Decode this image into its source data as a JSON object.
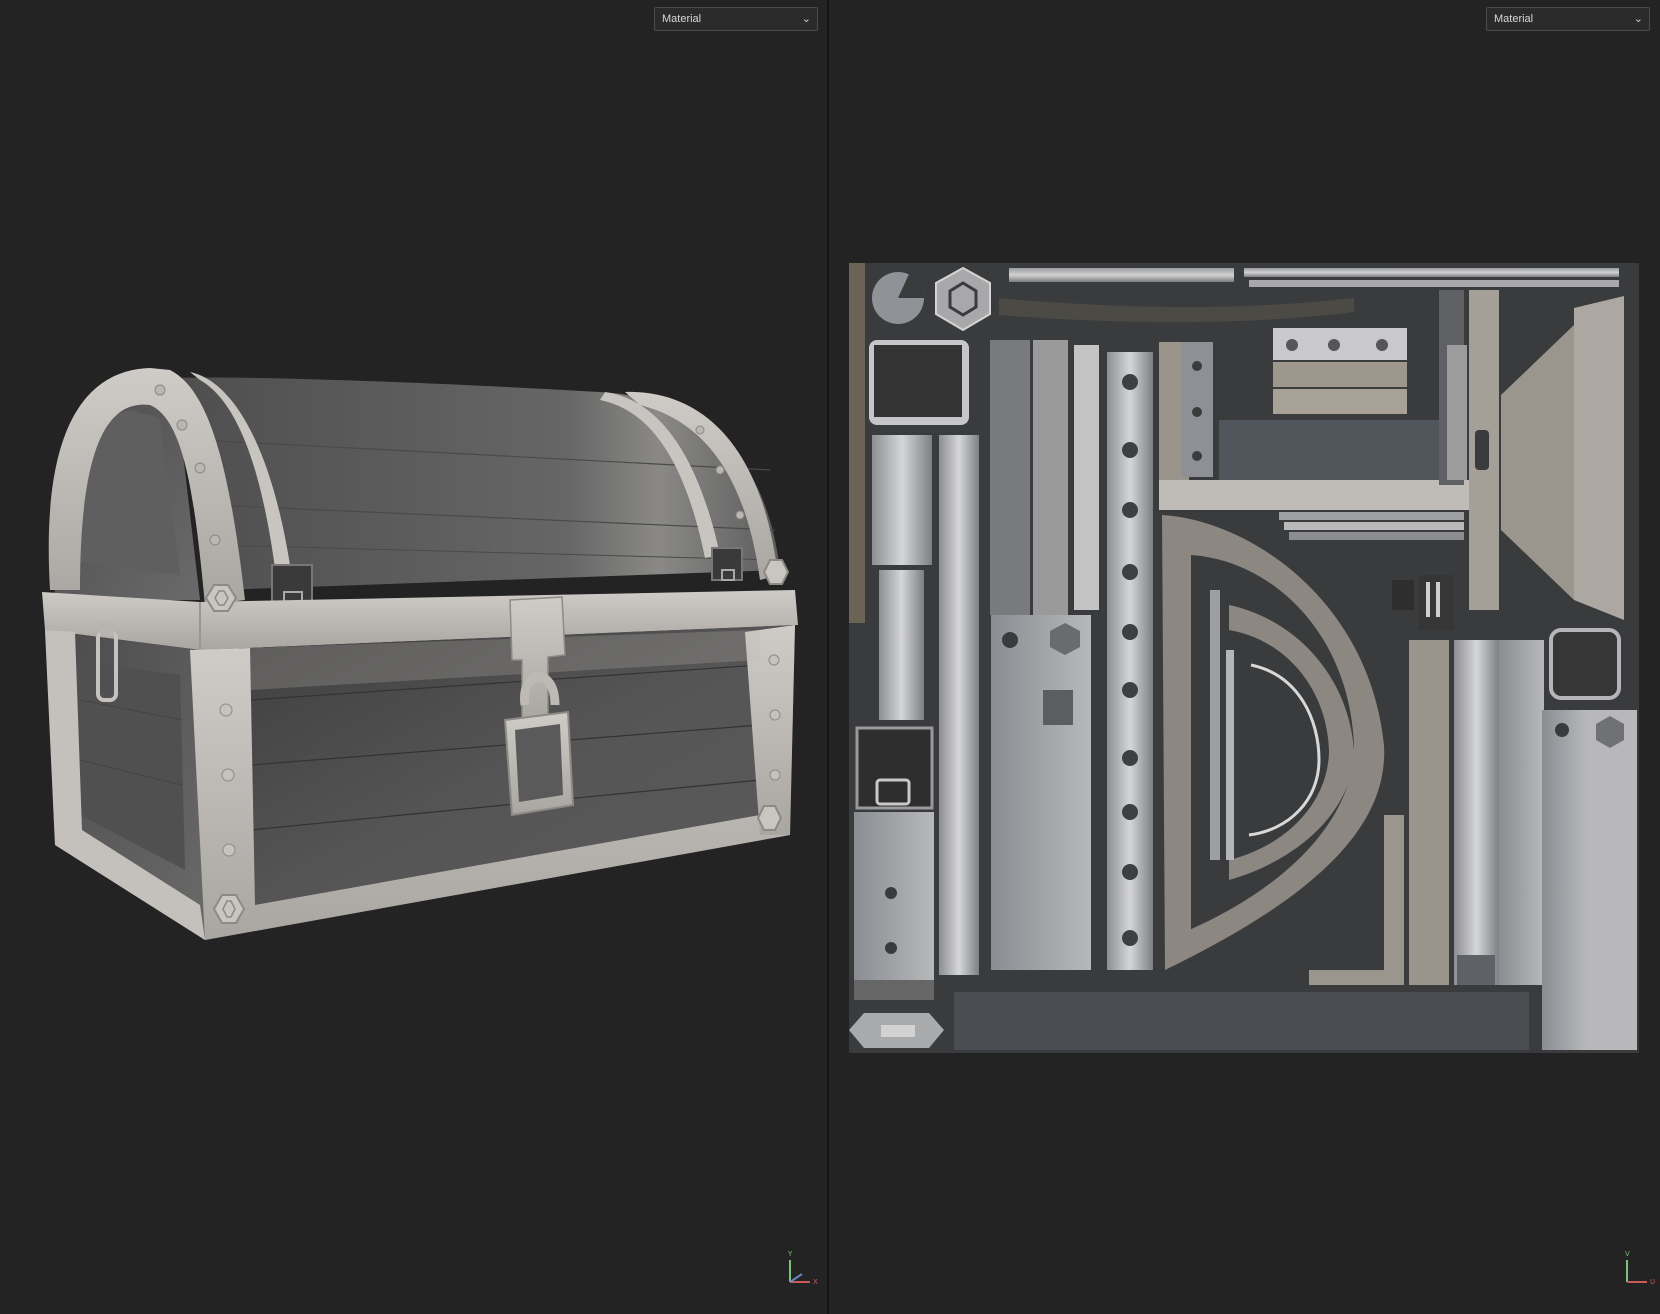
{
  "viewport_3d": {
    "shading_mode": "Material",
    "gizmo": {
      "up": "Y",
      "right": "X",
      "up_color": "#7cc07c",
      "right_color": "#c85a5a",
      "depth_color": "#6a82c8"
    }
  },
  "viewport_uv": {
    "shading_mode": "Material",
    "gizmo": {
      "up": "V",
      "right": "U",
      "up_color": "#7cc07c",
      "right_color": "#c85a5a"
    }
  },
  "icons": {
    "dropdown": "chevron-down-icon",
    "gizmo": "axis-gizmo-icon"
  },
  "colors": {
    "background": "#232323",
    "uv_canvas": "#3a3b3d",
    "chest_metal": "#bdbab5",
    "chest_wood": "#5a5a5a"
  }
}
